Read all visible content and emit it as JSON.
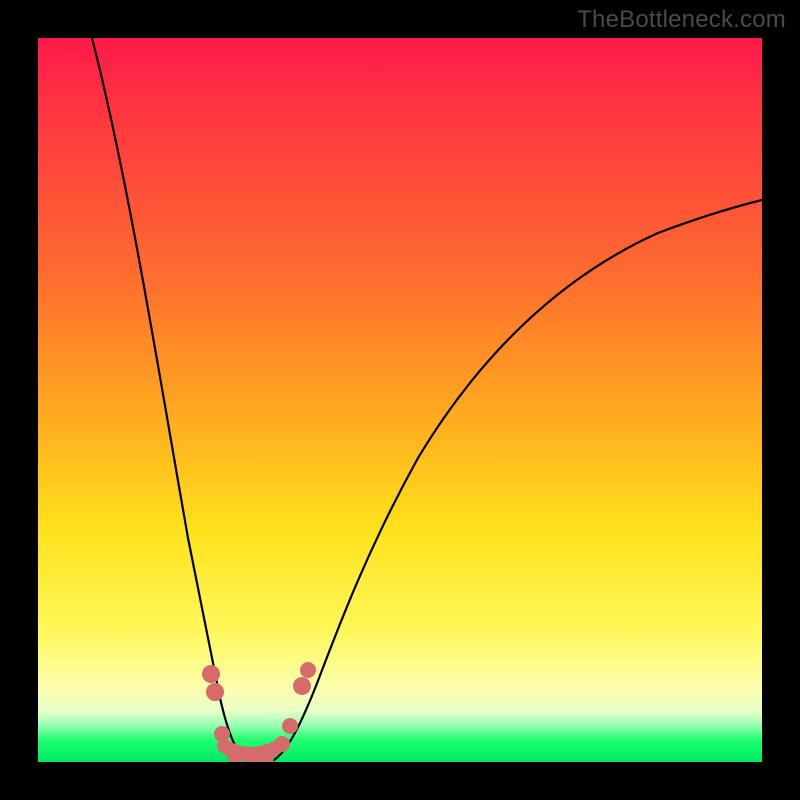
{
  "watermark": "TheBottleneck.com",
  "colors": {
    "page_bg": "#000000",
    "gradient_top": "#ff1a4a",
    "gradient_bottom": "#00e867",
    "curve": "#000000",
    "markers": "#d76a6a"
  },
  "chart_data": {
    "type": "line",
    "title": "",
    "xlabel": "",
    "ylabel": "",
    "x": [
      0,
      5,
      10,
      15,
      20,
      22,
      24,
      26,
      28,
      30,
      32,
      34,
      40,
      50,
      60,
      70,
      80,
      90,
      100
    ],
    "series": [
      {
        "name": "bottleneck-curve",
        "values": [
          100,
          78,
          55,
          30,
          8,
          2,
          0,
          0,
          0,
          3,
          8,
          14,
          30,
          48,
          60,
          69,
          75,
          78,
          80
        ]
      }
    ],
    "xlim": [
      0,
      100
    ],
    "ylim": [
      0,
      100
    ],
    "markers": [
      {
        "x": 19.5,
        "y": 10
      },
      {
        "x": 20.5,
        "y": 7
      },
      {
        "x": 22,
        "y": 1.5
      },
      {
        "x": 24,
        "y": 0
      },
      {
        "x": 26,
        "y": 0
      },
      {
        "x": 28,
        "y": 0.5
      },
      {
        "x": 29.5,
        "y": 2
      },
      {
        "x": 31,
        "y": 5
      },
      {
        "x": 33,
        "y": 10
      },
      {
        "x": 34,
        "y": 12
      }
    ]
  }
}
